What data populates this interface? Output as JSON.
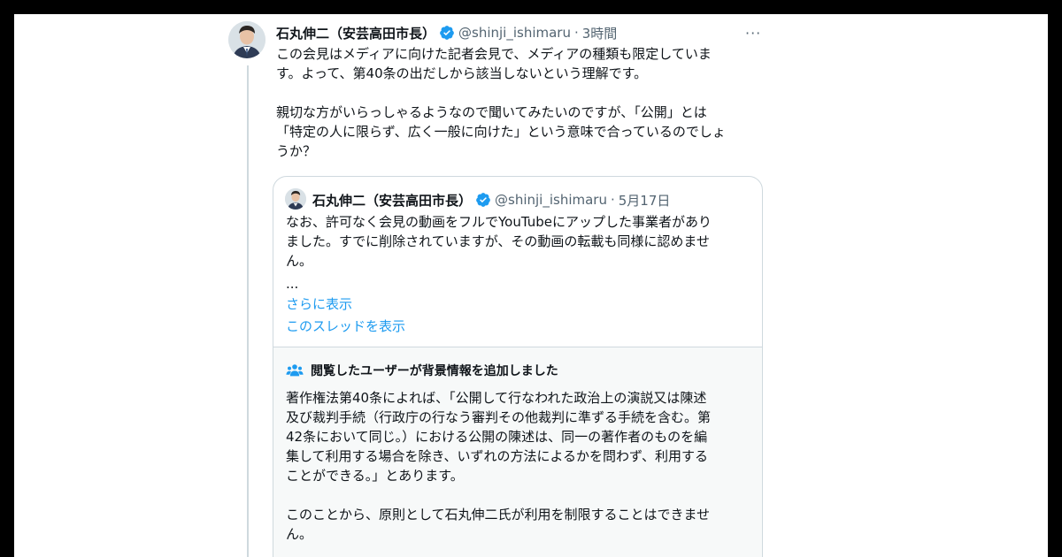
{
  "tweet": {
    "author_name": "石丸伸二（安芸高田市長）",
    "handle": "@shinji_ishimaru",
    "separator": "·",
    "time": "3時間",
    "more_label": "···",
    "text": "この会見はメディアに向けた記者会見で、メディアの種類も限定していま\nす。よって、第40条の出だしから該当しないという理解です。\n\n親切な方がいらっしゃるようなので聞いてみたいのですが、「公開」とは\n「特定の人に限らず、広く一般に向けた」という意味で合っているのでしょ\nうか？"
  },
  "quoted_tweet": {
    "author_name": "石丸伸二（安芸高田市長）",
    "handle": "@shinji_ishimaru",
    "separator": "·",
    "date": "5月17日",
    "text": "なお、許可なく会見の動画をフルでYouTubeにアップした事業者があり\nました。すでに削除されていますが、その動画の転載も同様に認めませ\nん。",
    "ellipsis": "...",
    "show_more": "さらに表示",
    "show_thread": "このスレッドを表示"
  },
  "community_note": {
    "icon": "people-icon",
    "title": "閲覧したユーザーが背景情報を追加しました",
    "text": "著作権法第40条によれば、「公開して行なわれた政治上の演説又は陳述\n及び裁判手続（行政庁の行なう審判その他裁判に準ずる手続を含む。第\n42条において同じ。）における公開の陳述は、同一の著作者のものを編\n集して利用する場合を除き、いずれの方法によるかを問わず、利用する\nことができる。」とあります。\n\nこのことから、原則として石丸伸二氏が利用を制限することはできませ\nん。"
  },
  "colors": {
    "accent": "#1d9bf0",
    "secondary_text": "#536471",
    "border": "#cfd9de",
    "note_background": "#f7f9f9"
  }
}
